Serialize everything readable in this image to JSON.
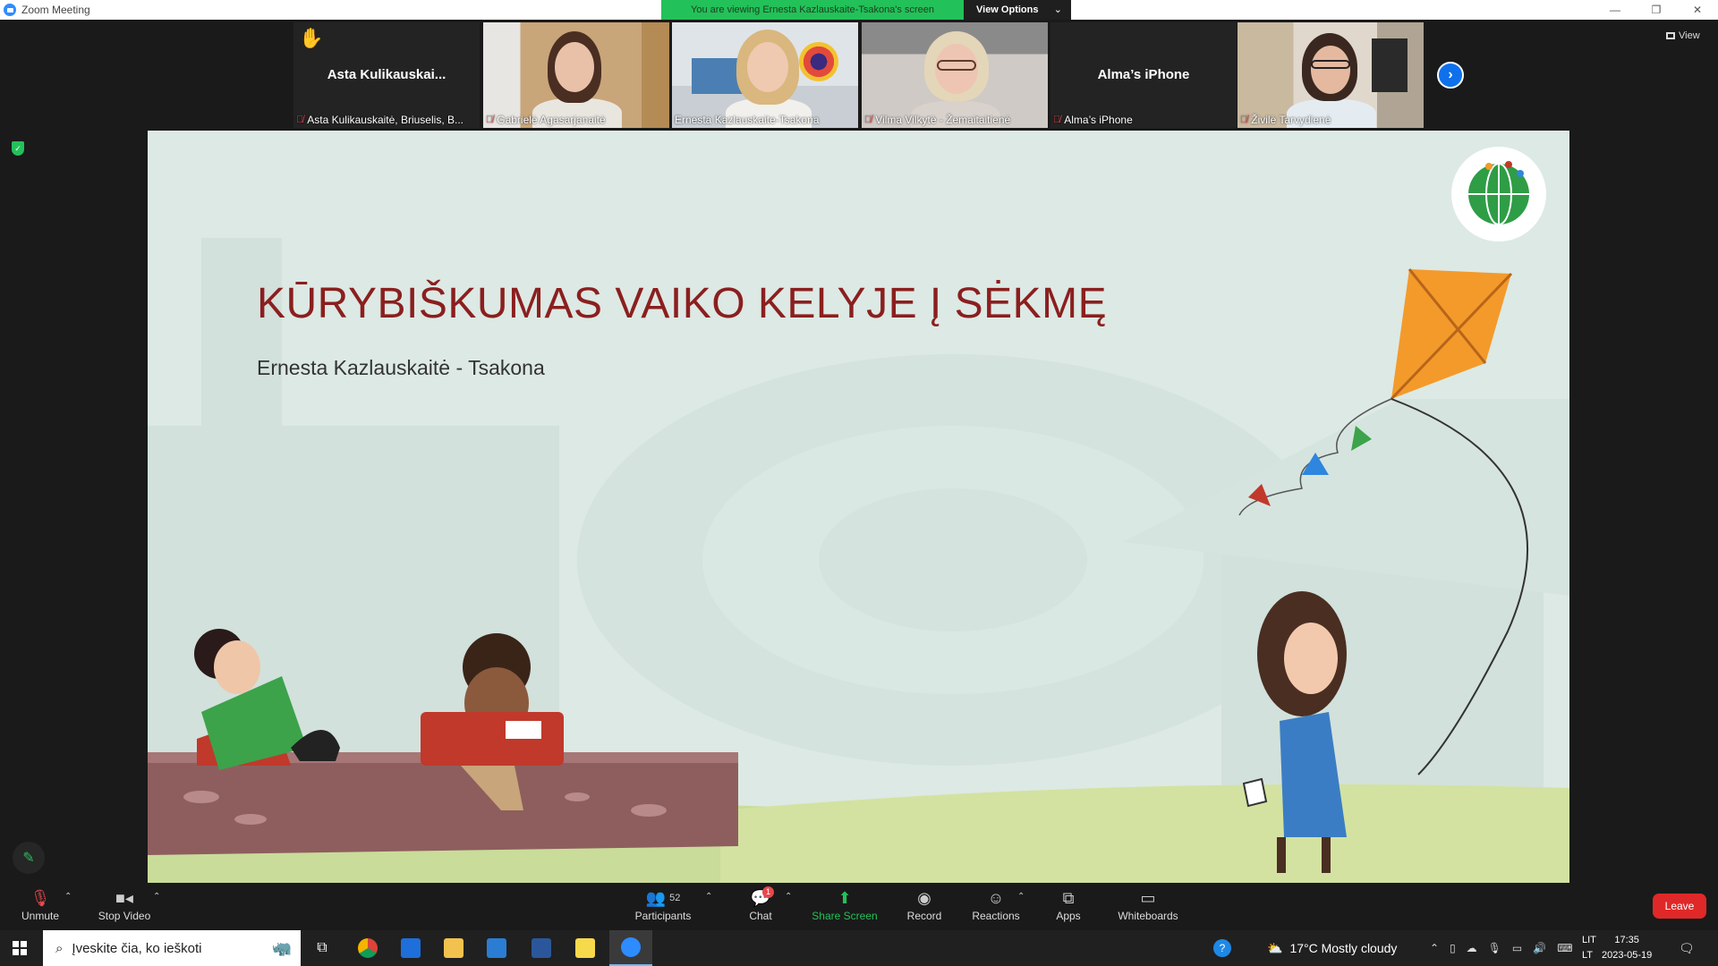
{
  "window": {
    "title": "Zoom Meeting"
  },
  "banner": {
    "message": "You are viewing Ernesta Kazlauskaite-Tsakona's screen",
    "view_options": "View Options"
  },
  "participants_strip": [
    {
      "name": "Asta Kulikauskaitė, Briuselis, B...",
      "big_name": "Asta  Kulikauskai...",
      "muted": true,
      "hand_raised": true
    },
    {
      "name": "Gabrielė Agasarjanaitė",
      "muted": true
    },
    {
      "name": "Ernesta Kazlauskaite-Tsakona",
      "muted": false,
      "active": true
    },
    {
      "name": "Vilma Vilkytė - Žemaitaitienė",
      "muted": true
    },
    {
      "name": "Alma’s iPhone",
      "big_name": "Alma’s iPhone",
      "muted": true
    },
    {
      "name": "Živilė Tarvydienė",
      "muted": true
    }
  ],
  "view_button": "View",
  "slide": {
    "title": "KŪRYBIŠKUMAS VAIKO KELYJE Į SĖKMĘ",
    "subtitle": "Ernesta Kazlauskaitė - Tsakona"
  },
  "toolbar": {
    "unmute": "Unmute",
    "stop_video": "Stop Video",
    "participants": "Participants",
    "participants_count": "52",
    "chat": "Chat",
    "chat_badge": "1",
    "share_screen": "Share Screen",
    "record": "Record",
    "reactions": "Reactions",
    "apps": "Apps",
    "whiteboards": "Whiteboards",
    "leave": "Leave"
  },
  "taskbar": {
    "search_placeholder": "Įveskite čia, ko ieškoti",
    "weather": "17°C  Mostly cloudy",
    "lang_top": "LIT",
    "lang_bottom": "LT",
    "time": "17:35",
    "date": "2023-05-19"
  },
  "colors": {
    "accent": "#2D8CFF",
    "green": "#23C159",
    "leave": "#e02828",
    "slide_title": "#8b1f1f"
  }
}
